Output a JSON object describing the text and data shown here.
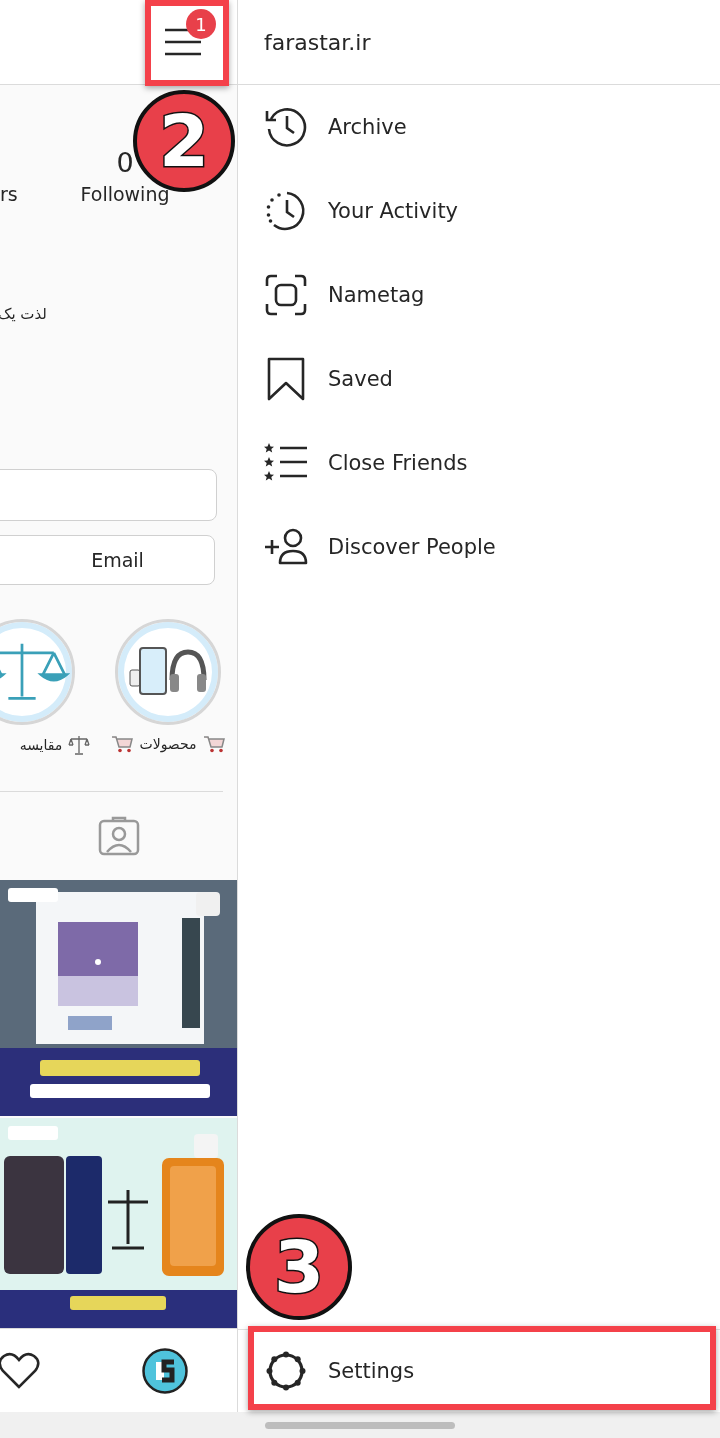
{
  "profile": {
    "stats": [
      {
        "label": "rs"
      },
      {
        "value": "0",
        "label": "Following"
      }
    ],
    "bio": "لذت یک",
    "email_button": "Email",
    "highlights": [
      {
        "kind": "products",
        "label": "محصولات"
      },
      {
        "kind": "compare",
        "label": "مقایسه"
      }
    ]
  },
  "drawer": {
    "title": "farastar.ir",
    "items": [
      {
        "kind": "archive",
        "label": "Archive"
      },
      {
        "kind": "activity",
        "label": "Your Activity"
      },
      {
        "kind": "nametag",
        "label": "Nametag"
      },
      {
        "kind": "saved",
        "label": "Saved"
      },
      {
        "kind": "close_friends",
        "label": "Close Friends"
      },
      {
        "kind": "discover",
        "label": "Discover People"
      }
    ],
    "settings": "Settings"
  },
  "steps": [
    {
      "label": "1"
    },
    {
      "label": "2"
    },
    {
      "label": "3"
    }
  ]
}
